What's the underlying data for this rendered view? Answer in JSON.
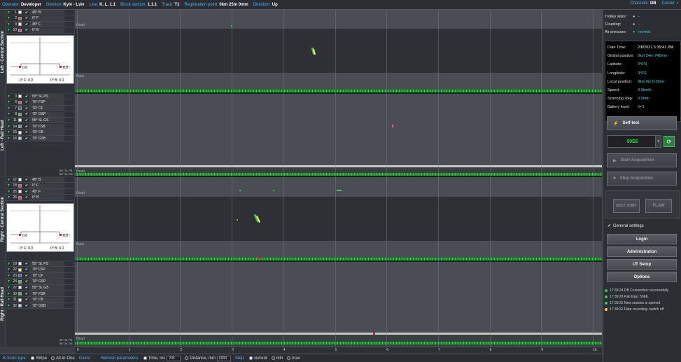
{
  "topbar": {
    "operator_label": "Operator:",
    "operator": "Developer",
    "division_label": "Division:",
    "division": "Kyiv - Lviv",
    "line_label": "Line:",
    "line": "K. L. 1.1",
    "block_label": "Block section:",
    "block": "1.1.1",
    "track_label": "Track:",
    "track": "T1",
    "reg_label": "Registration point:",
    "reg": "0km 25m 0mm",
    "dir_label": "Direction:",
    "dir": "Up",
    "channels_label": "Channels:",
    "channels": "DB",
    "center_label": "Center:",
    "center": "-"
  },
  "sections": {
    "left_central": "Left - Central Section",
    "left_head": "Left - Rail Head",
    "right_central": "Right - Central Section",
    "right_head": "Right - Rail Head"
  },
  "left_central_channels": [
    {
      "n": "1",
      "color": "#ffffff",
      "name": "45° B"
    },
    {
      "n": "2",
      "color": "#ff3b3b",
      "name": "0° F"
    },
    {
      "n": "9",
      "color": "#ffffff",
      "name": "45° F"
    },
    {
      "n": "10",
      "color": "#ff3b3b",
      "name": "0° B"
    }
  ],
  "left_head_channels": [
    {
      "n": "3",
      "color": "#ffffff",
      "name": "55° SL PS"
    },
    {
      "n": "6",
      "color": "#ff3b3b",
      "name": "70° FSP"
    },
    {
      "n": "7",
      "color": "#2f5bff",
      "name": "70° CF"
    },
    {
      "n": "8",
      "color": "#2fd14a",
      "name": "70° GSP"
    },
    {
      "n": "11",
      "color": "#ffffff",
      "name": "55° SL GS"
    },
    {
      "n": "14",
      "color": "#2fd14a",
      "name": "70° FSB"
    },
    {
      "n": "15",
      "color": "#ffffff",
      "name": "70° CB"
    },
    {
      "n": "16",
      "color": "#8fe8ff",
      "name": "70° GSB"
    }
  ],
  "right_central_channels": [
    {
      "n": "17",
      "color": "#ffffff",
      "name": "45° B"
    },
    {
      "n": "18",
      "color": "#ff3b3b",
      "name": "0° F"
    },
    {
      "n": "25",
      "color": "#ffffff",
      "name": "45° F"
    },
    {
      "n": "26",
      "color": "#ff3b3b",
      "name": "0° B"
    }
  ],
  "right_head_channels": [
    {
      "n": "19",
      "color": "#ffffff",
      "name": "55° SL PS"
    },
    {
      "n": "22",
      "color": "#ffff33",
      "name": "70° FSP"
    },
    {
      "n": "23",
      "color": "#2f5bff",
      "name": "70° CF"
    },
    {
      "n": "24",
      "color": "#2fd14a",
      "name": "70° GSP"
    },
    {
      "n": "27",
      "color": "#ffffff",
      "name": "55° SL GS"
    },
    {
      "n": "30",
      "color": "#2fd14a",
      "name": "70° FSB"
    },
    {
      "n": "31",
      "color": "#ffffff",
      "name": "70° CB"
    },
    {
      "n": "32",
      "color": "#8fe8ff",
      "name": "70° GSB"
    }
  ],
  "mini": {
    "val_left": "0.0",
    "val_right": "0.0",
    "label_f": "0° F: 0.0",
    "label_b": "0° B: 0.0",
    "foot_1": "55° SL PS",
    "foot_2": "55° SL GS"
  },
  "bscan": {
    "head_label": "Head",
    "base_label": "Base"
  },
  "x_ticks": [
    "0",
    "1",
    "2",
    "3",
    "4",
    "5",
    "6",
    "7",
    "8",
    "9",
    "10"
  ],
  "status": {
    "trolley_label": "Trolley state:",
    "trolley": "-",
    "coupling_label": "Coupling:",
    "coupling": "-",
    "air_label": "Air pressure:",
    "air": "normal"
  },
  "info": {
    "datetime_label": "Date Time:",
    "datetime": "2/8/2021 5:39:41 PM",
    "global_label": "Global position:",
    "global": "0km 24m 742mm",
    "lat_label": "Latitude:",
    "lat": "0°0'N",
    "lon_label": "Longitude:",
    "lon": "0°0'E",
    "local_label": "Local position:",
    "local": "0km 0m 0.0mm",
    "speed_label": "Speed:",
    "speed": "0.0km/h",
    "step_label": "Scanning step:",
    "step": "0.0mm",
    "battery_label": "Battery level:",
    "battery": "0+0"
  },
  "buttons": {
    "self_test": "Self-test",
    "rail_type": "50E6",
    "start": "Start Acquisition",
    "stop": "Stop Acquisition",
    "bolt_joint": "BOLT JOINT",
    "flaw": "FLAW",
    "general_settings": "General settings",
    "login": "Login",
    "administration": "Administration",
    "ut_setup": "UT Setup",
    "options": "Options"
  },
  "log": [
    {
      "color": "#2fd14a",
      "text": "17:39:24 DB Connection: successfully"
    },
    {
      "color": "#2fd14a",
      "text": "17:39:29 Rail type: 50E6"
    },
    {
      "color": "#2fd14a",
      "text": "17:39:31 New session is opened"
    },
    {
      "color": "#ffd21f",
      "text": "17:39:31 Data recording: switch off"
    }
  ],
  "bottom": {
    "bscan_type_label": "B-Scan type:",
    "stripe": "Stripe",
    "allinone": "All-in-One",
    "gains_label": "Gains:",
    "refresh_label": "Refresh parameters:",
    "time_label": "Time, ms",
    "time": "200",
    "distance_label": "Distance, mm",
    "distance": "6600",
    "step_label": "Step:",
    "current": "current",
    "min": "min",
    "max": "max"
  }
}
